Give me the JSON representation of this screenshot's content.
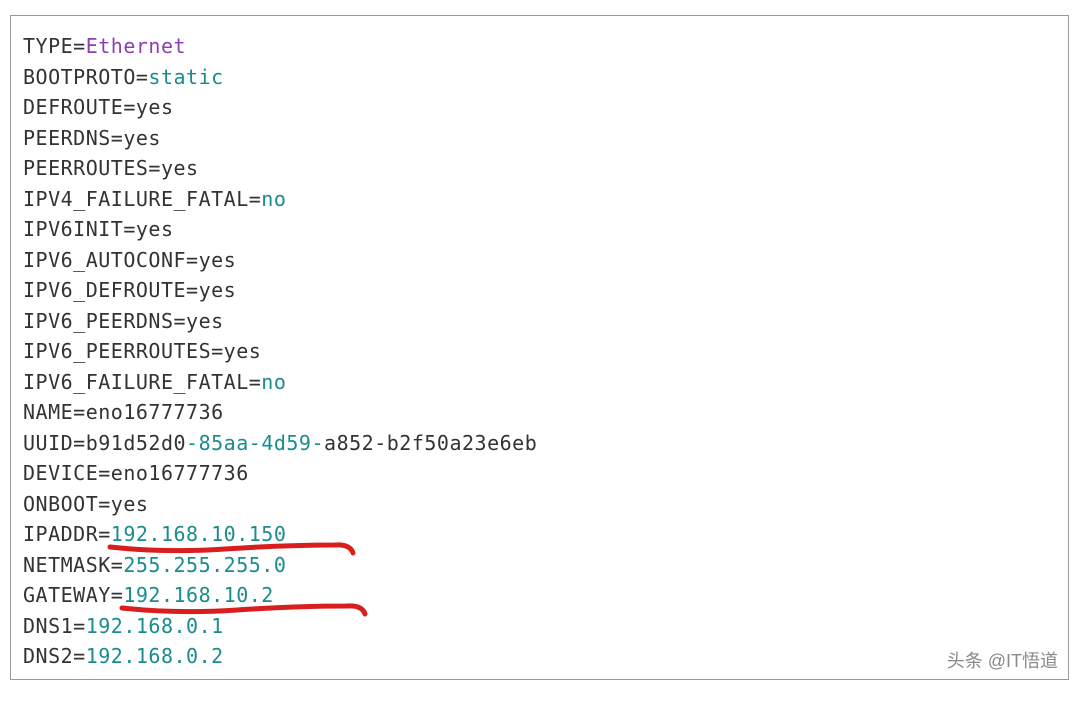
{
  "config": {
    "lines": [
      {
        "key": "TYPE",
        "value": "Ethernet",
        "valueClass": "purple"
      },
      {
        "key": "BOOTPROTO",
        "value": "static",
        "valueClass": "teal"
      },
      {
        "key": "DEFROUTE",
        "value": "yes",
        "valueClass": "val"
      },
      {
        "key": "PEERDNS",
        "value": "yes",
        "valueClass": "val"
      },
      {
        "key": "PEERROUTES",
        "value": "yes",
        "valueClass": "val"
      },
      {
        "key": "IPV4_FAILURE_FATAL",
        "value": "no",
        "valueClass": "teal"
      },
      {
        "key": "IPV6INIT",
        "value": "yes",
        "valueClass": "val"
      },
      {
        "key": "IPV6_AUTOCONF",
        "value": "yes",
        "valueClass": "val"
      },
      {
        "key": "IPV6_DEFROUTE",
        "value": "yes",
        "valueClass": "val"
      },
      {
        "key": "IPV6_PEERDNS",
        "value": "yes",
        "valueClass": "val"
      },
      {
        "key": "IPV6_PEERROUTES",
        "value": "yes",
        "valueClass": "val"
      },
      {
        "key": "IPV6_FAILURE_FATAL",
        "value": "no",
        "valueClass": "teal"
      },
      {
        "key": "NAME",
        "value": "eno16777736",
        "valueClass": "val"
      },
      {
        "key": "UUID",
        "segments": [
          {
            "text": "b91d52d0",
            "cls": "val"
          },
          {
            "text": "-",
            "cls": "teal"
          },
          {
            "text": "85aa",
            "cls": "teal"
          },
          {
            "text": "-",
            "cls": "teal"
          },
          {
            "text": "4d59",
            "cls": "teal"
          },
          {
            "text": "-",
            "cls": "teal"
          },
          {
            "text": "a852",
            "cls": "val"
          },
          {
            "text": "-",
            "cls": "val"
          },
          {
            "text": "b2f50a23e6eb",
            "cls": "val"
          }
        ]
      },
      {
        "key": "DEVICE",
        "value": "eno16777736",
        "valueClass": "val"
      },
      {
        "key": "ONBOOT",
        "value": "yes",
        "valueClass": "val"
      },
      {
        "key": "IPADDR",
        "value": "192.168.10.150",
        "valueClass": "teal",
        "mark": true
      },
      {
        "key": "NETMASK",
        "value": "255.255.255.0",
        "valueClass": "teal"
      },
      {
        "key": "GATEWAY",
        "value": "192.168.10.2",
        "valueClass": "teal",
        "mark": true
      },
      {
        "key": "DNS1",
        "value": "192.168.0.1",
        "valueClass": "teal"
      },
      {
        "key": "DNS2",
        "value": "192.168.0.2",
        "valueClass": "teal"
      }
    ]
  },
  "watermark": "头条 @IT悟道"
}
